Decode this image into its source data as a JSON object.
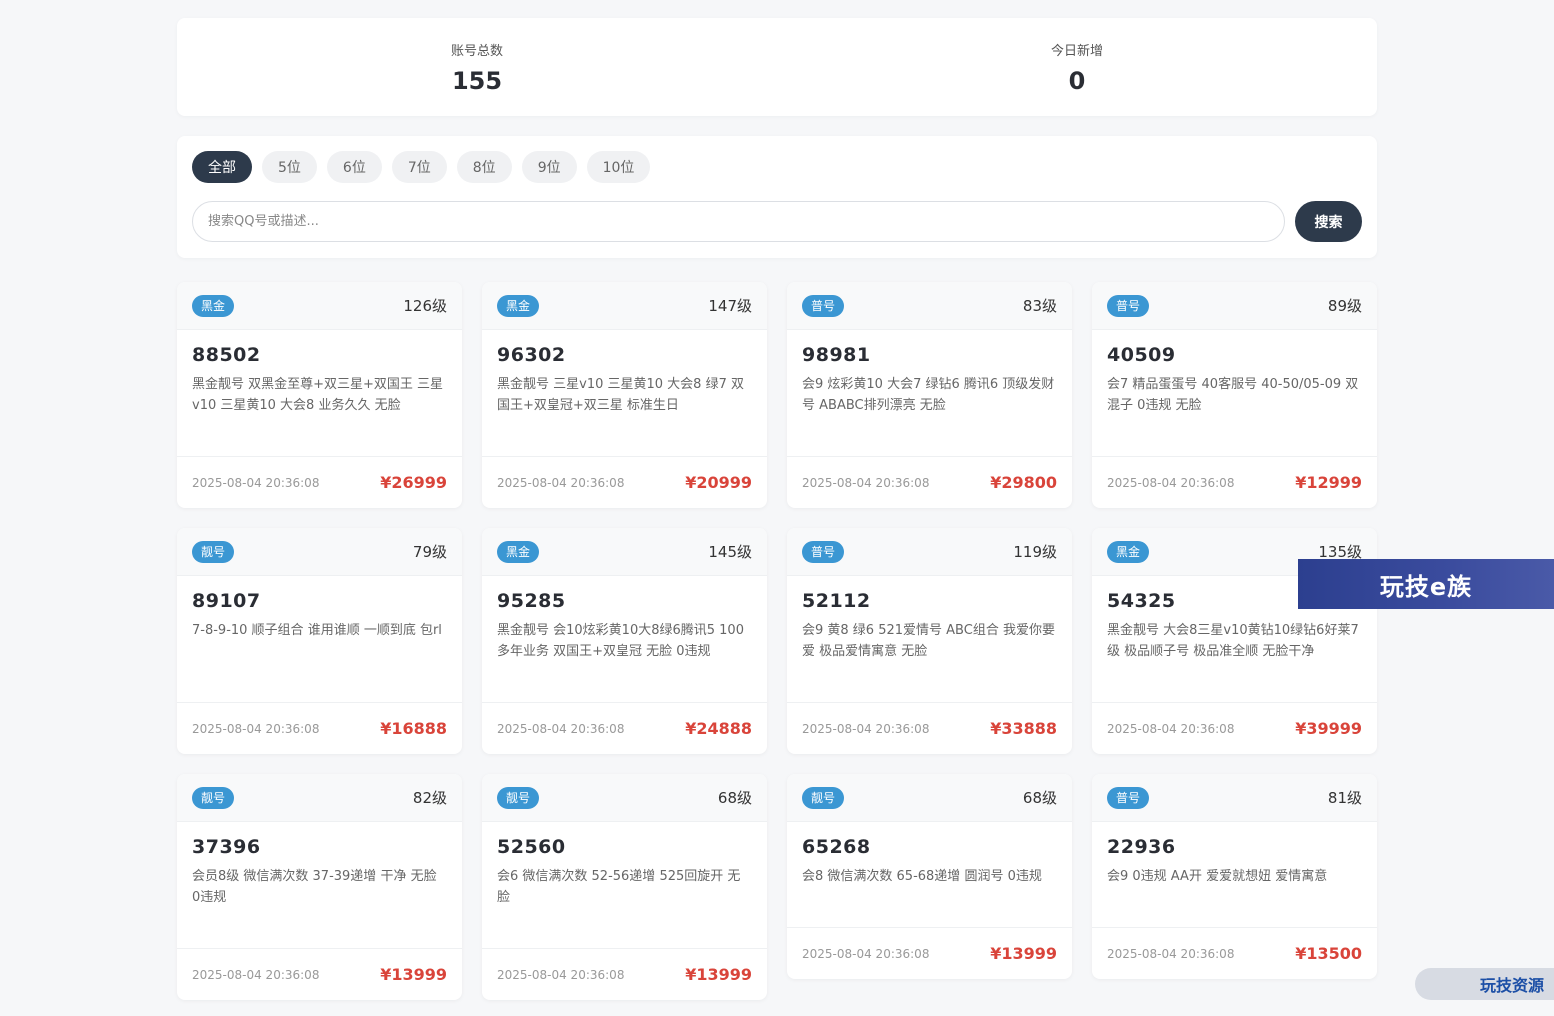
{
  "stats": {
    "total_label": "账号总数",
    "total_value": "155",
    "today_label": "今日新增",
    "today_value": "0"
  },
  "filters": {
    "tabs": [
      "全部",
      "5位",
      "6位",
      "7位",
      "8位",
      "9位",
      "10位"
    ],
    "active": 0
  },
  "search": {
    "placeholder": "搜索QQ号或描述...",
    "button": "搜索"
  },
  "cards": [
    {
      "badge": "黑金",
      "level": "126级",
      "qq": "88502",
      "desc": "黑金靓号 双黑金至尊+双三星+双国王 三星v10 三星黄10 大会8 业务久久 无脸",
      "time": "2025-08-04 20:36:08",
      "price": "¥26999"
    },
    {
      "badge": "黑金",
      "level": "147级",
      "qq": "96302",
      "desc": "黑金靓号 三星v10 三星黄10 大会8 绿7 双国王+双皇冠+双三星 标准生日",
      "time": "2025-08-04 20:36:08",
      "price": "¥20999"
    },
    {
      "badge": "普号",
      "level": "83级",
      "qq": "98981",
      "desc": "会9 炫彩黄10 大会7 绿钻6 腾讯6 顶级发财号 ABABC排列漂亮 无脸",
      "time": "2025-08-04 20:36:08",
      "price": "¥29800"
    },
    {
      "badge": "普号",
      "level": "89级",
      "qq": "40509",
      "desc": "会7 精品蛋蛋号 40客服号 40-50/05-09 双混子 0违规 无脸",
      "time": "2025-08-04 20:36:08",
      "price": "¥12999"
    },
    {
      "badge": "靓号",
      "level": "79级",
      "qq": "89107",
      "desc": "7-8-9-10 顺子组合 谁用谁顺 一顺到底 包rl",
      "time": "2025-08-04 20:36:08",
      "price": "¥16888"
    },
    {
      "badge": "黑金",
      "level": "145级",
      "qq": "95285",
      "desc": "黑金靓号 会10炫彩黄10大8绿6腾讯5 100多年业务 双国王+双皇冠 无脸 0违规",
      "time": "2025-08-04 20:36:08",
      "price": "¥24888"
    },
    {
      "badge": "普号",
      "level": "119级",
      "qq": "52112",
      "desc": "会9 黄8 绿6 521爱情号 ABC组合 我爱你要爱 极品爱情寓意 无脸",
      "time": "2025-08-04 20:36:08",
      "price": "¥33888"
    },
    {
      "badge": "黑金",
      "level": "135级",
      "qq": "54325",
      "desc": "黑金靓号 大会8三星v10黄钻10绿钻6好莱7级 极品顺子号 极品准全顺 无脸干净",
      "time": "2025-08-04 20:36:08",
      "price": "¥39999"
    },
    {
      "badge": "靓号",
      "level": "82级",
      "qq": "37396",
      "desc": "会员8级 微信满次数 37-39递增 干净 无脸 0违规",
      "time": "2025-08-04 20:36:08",
      "price": "¥13999"
    },
    {
      "badge": "靓号",
      "level": "68级",
      "qq": "52560",
      "desc": "会6 微信满次数 52-56递增 525回旋开 无脸",
      "time": "2025-08-04 20:36:08",
      "price": "¥13999"
    },
    {
      "badge": "靓号",
      "level": "68级",
      "qq": "65268",
      "desc": "会8 微信满次数 65-68递增 圆润号 0违规",
      "time": "2025-08-04 20:36:08",
      "price": "¥13999"
    },
    {
      "badge": "普号",
      "level": "81级",
      "qq": "22936",
      "desc": "会9 0违规 AA开 爱爱就想妞 爱情寓意",
      "time": "2025-08-04 20:36:08",
      "price": "¥13500"
    }
  ],
  "watermarks": {
    "banner": "玩技e族",
    "tag": "玩技资源"
  },
  "colors": {
    "badge": "#3b97d3",
    "price": "#d9443a",
    "primary_dark": "#2d3a4b"
  }
}
